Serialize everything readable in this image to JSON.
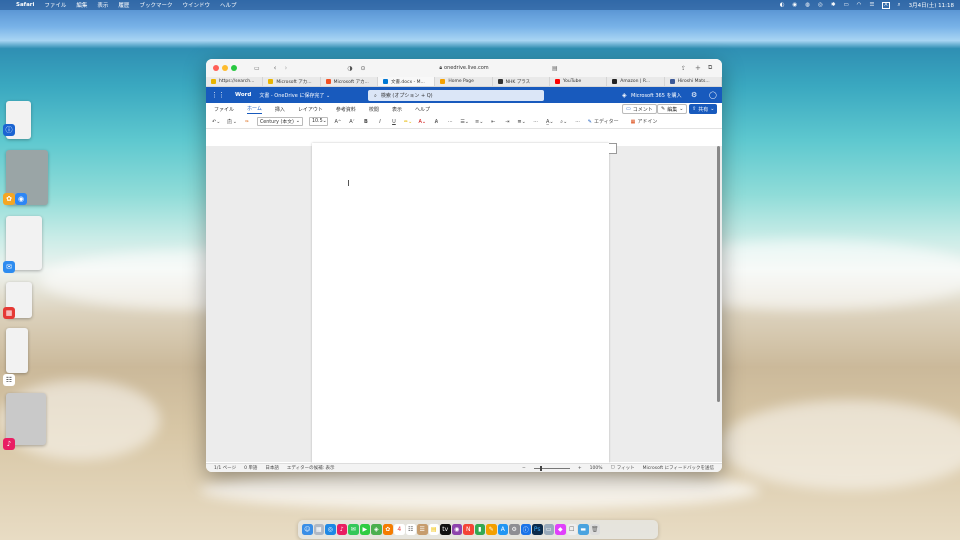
{
  "menubar": {
    "apple": "",
    "app": "Safari",
    "items": [
      "ファイル",
      "編集",
      "表示",
      "履歴",
      "ブックマーク",
      "ウインドウ",
      "ヘルプ"
    ],
    "input": "A",
    "clock": "3月4日(土) 11:18"
  },
  "safari": {
    "url": "onedrive.live.com",
    "tabs": [
      "https://search...",
      "Microsoft アカ...",
      "Microsoft アカ...",
      "文書.docx - M...",
      "Home Page",
      "NHK プラス",
      "YouTube",
      "Amazon | R...",
      "Hiroshi Mats..."
    ]
  },
  "word": {
    "app_name": "Word",
    "doc_title": "文書 - OneDrive に保存完了 ⌄",
    "search_placeholder": "検索 (オプション + Q)",
    "m365": "Microsoft 365 を購入",
    "menu_tabs": [
      "ファイル",
      "ホーム",
      "挿入",
      "レイアウト",
      "参考資料",
      "校閲",
      "表示",
      "ヘルプ"
    ],
    "comment": "コメント",
    "edit": "編集",
    "share": "共有",
    "font": "Century (本文)",
    "size": "10.5",
    "editor": "エディター",
    "addin": "アドイン",
    "status": {
      "page": "1/1 ページ",
      "words": "0 単語",
      "lang": "日本語",
      "editor": "エディターの候補: 表示",
      "zoom": "100%",
      "fit": "フィット",
      "feedback": "Microsoft にフィードバックを送信"
    }
  },
  "colors": {
    "word_blue": "#185abd",
    "accent": "#185abd"
  }
}
